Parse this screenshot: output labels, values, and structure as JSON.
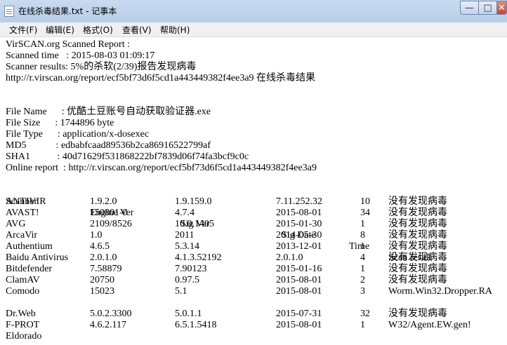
{
  "window": {
    "title": "在线杀毒结果.txt - 记事本",
    "controls": {
      "minimize": "—",
      "maximize": "□",
      "close": "✕"
    }
  },
  "menu": [
    "文件(F)",
    "编辑(E)",
    "格式(O)",
    "查看(V)",
    "帮助(H)"
  ],
  "report": {
    "header": "VirSCAN.org Scanned Report :",
    "scanned_time": "Scanned time   : 2015-08-03 01:09:17",
    "scanner_results": "Scanner results: 5%的杀软(2/39)报告发现病毒",
    "url_line": "http://r.virscan.org/report/ecf5bf73d6f5cd1a443449382f4ee3a9 在线杀毒结果",
    "file_info": [
      "File Name      : 优酷土豆账号自动获取验证器.exe",
      "File Size      : 1744896 byte",
      "File Type      : application/x-dosexec",
      "MD5            : edbabfcaad89536b2ca86916522799af",
      "SHA1           : 40d71629f531868222bf7839d06f74fa3bcf9c0c",
      "Online report  : http://r.virscan.org/report/ecf5bf73d6f5cd1a443449382f4ee3a9"
    ],
    "table_headers": [
      "Scanner",
      "Engine Ver",
      "Sig Ver",
      "Sig Date",
      "Time",
      "Scan result"
    ],
    "rows": [
      [
        "ANTIVIR",
        "1.9.2.0",
        "1.9.159.0",
        "7.11.252.32",
        "10",
        "没有发现病毒"
      ],
      [
        "AVAST!",
        "150801-0",
        "4.7.4",
        "2015-08-01",
        "34",
        "没有发现病毒"
      ],
      [
        "AVG",
        "2109/8526",
        "10.0.1405",
        "2015-01-30",
        "1",
        "没有发现病毒"
      ],
      [
        "ArcaVir",
        "1.0",
        "2011",
        "2014-05-30",
        "8",
        "没有发现病毒"
      ],
      [
        "Authentium",
        "4.6.5",
        "5.3.14",
        "2013-12-01",
        "1",
        "没有发现病毒"
      ],
      [
        "Baidu Antivirus",
        "2.0.1.0",
        "4.1.3.52192",
        "2.0.1.0",
        "4",
        "没有发现病毒"
      ],
      [
        "Bitdefender",
        "7.58879",
        "7.90123",
        "2015-01-16",
        "1",
        "没有发现病毒"
      ],
      [
        "ClamAV",
        "20750",
        "0.97.5",
        "2015-08-01",
        "2",
        "没有发现病毒"
      ],
      [
        "Comodo",
        "15023",
        "5.1",
        "2015-08-01",
        "3",
        "Worm.Win32.Dropper.RA"
      ],
      [
        "",
        "",
        "",
        "",
        "",
        ""
      ],
      [
        "Dr.Web",
        "5.0.2.3300",
        "5.0.1.1",
        "2015-07-31",
        "32",
        "没有发现病毒"
      ],
      [
        "F-PROT",
        "4.6.2.117",
        "6.5.1.5418",
        "2015-08-01",
        "1",
        "W32/Agent.EW.gen!"
      ],
      [
        "Eldorado",
        "",
        "",
        "",
        "",
        ""
      ]
    ]
  }
}
